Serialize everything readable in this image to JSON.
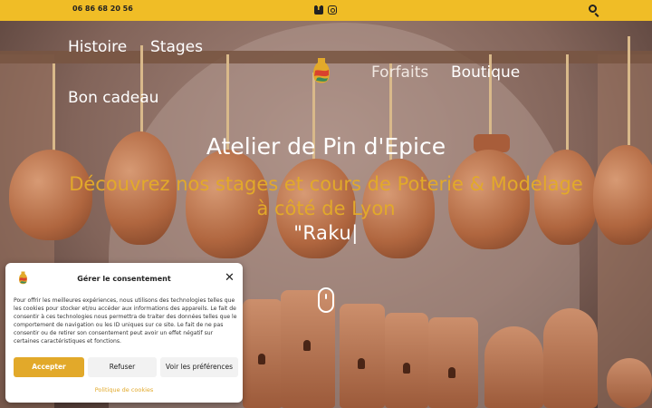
{
  "topbar": {
    "phone": "06 86 68 20 56",
    "social_icons": [
      "facebook-square-icon",
      "instagram-icon"
    ],
    "search_icon": "search-icon",
    "background_color": "#f0bd26"
  },
  "nav": {
    "items": [
      "Histoire",
      "Stages",
      "Forfaits",
      "Boutique",
      "Bon cadeau"
    ]
  },
  "hero": {
    "title": "Atelier de Pin d'Epice",
    "subtitle_line1": "Découvrez nos stages et cours de Poterie & Modelage",
    "subtitle_line2": "à côté de Lyon",
    "typed_text": "\"Raku|",
    "accent_color": "#e2a92a"
  },
  "consent": {
    "title": "Gérer le consentement",
    "text": "Pour offrir les meilleures expériences, nous utilisons des technologies telles que les cookies pour stocker et/ou accéder aux informations des appareils. Le fait de consentir à ces technologies nous permettra de traiter des données telles que le comportement de navigation ou les ID uniques sur ce site. Le fait de ne pas consentir ou de retirer son consentement peut avoir un effet négatif sur certaines caractéristiques et fonctions.",
    "accept": "Accepter",
    "refuse": "Refuser",
    "preferences": "Voir les préférences",
    "policy": "Politique de cookies"
  }
}
